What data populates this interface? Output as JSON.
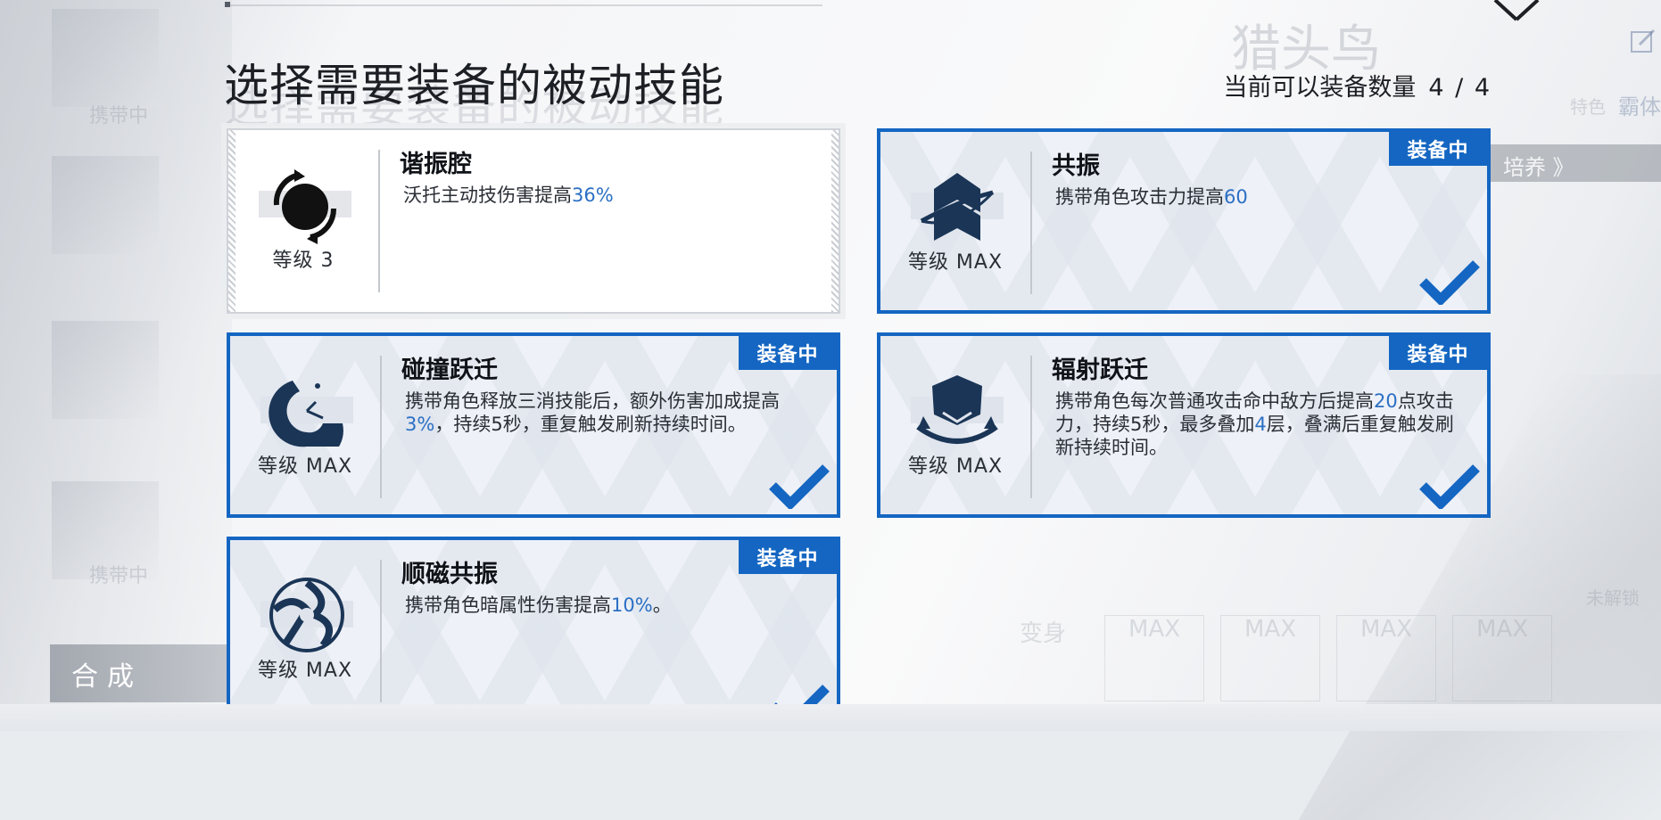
{
  "header": {
    "title": "选择需要装备的被动技能",
    "capacity_label": "当前可以装备数量",
    "capacity_value": "4 / 4"
  },
  "background": {
    "carry_label": "携带中",
    "char_name": "猎头鸟",
    "trait_label": "特色",
    "trait_value": "霸体",
    "train_label": "培养 》",
    "locked_label": "未解锁",
    "slot_level_label": "等级",
    "slot_level_value": "MAX",
    "slot_variant_label": "变身"
  },
  "synth_button": {
    "label": "合成"
  },
  "skills": [
    {
      "name": "谐振腔",
      "level": "等级 3",
      "desc_parts": [
        "沃托主动技伤害提高",
        "36%",
        ""
      ],
      "equipped": false,
      "icon": "resonance-chamber-icon"
    },
    {
      "name": "共振",
      "level": "等级 MAX",
      "desc_parts": [
        "携带角色攻击力提高",
        "60",
        ""
      ],
      "equipped": true,
      "badge": "装备中",
      "icon": "resonance-chevron-icon"
    },
    {
      "name": "碰撞跃迁",
      "level": "等级 MAX",
      "desc_parts": [
        "携带角色释放三消技能后，额外伤害加成提高",
        "3%",
        "，持续5秒，重复触发刷新持续时间。"
      ],
      "equipped": true,
      "badge": "装备中",
      "icon": "collision-gauge-icon"
    },
    {
      "name": "辐射跃迁",
      "level": "等级 MAX",
      "desc_parts": [
        "携带角色每次普通攻击命中敌方后提高",
        "20",
        "点攻击力，持续5秒，最多叠加",
        "4",
        "层，叠满后重复触发刷新持续时间。"
      ],
      "equipped": true,
      "badge": "装备中",
      "icon": "radiation-shield-icon"
    },
    {
      "name": "顺磁共振",
      "level": "等级 MAX",
      "desc_parts": [
        "携带角色暗属性伤害提高",
        "10%",
        "。"
      ],
      "equipped": true,
      "badge": "装备中",
      "icon": "paramagnetic-swirl-icon"
    }
  ],
  "colors": {
    "accent": "#1466c2",
    "highlight": "#2b6fc4",
    "title_text": "#1c1f24"
  }
}
